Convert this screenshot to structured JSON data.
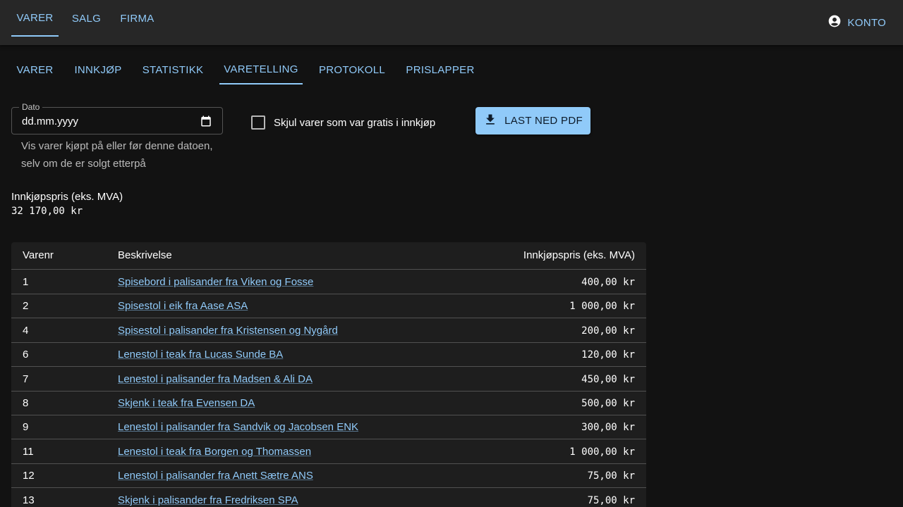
{
  "topnav": {
    "tabs": [
      "VARER",
      "SALG",
      "FIRMA"
    ],
    "active": "VARER",
    "account_label": "KONTO",
    "account_icon": "account-circle-icon"
  },
  "subnav": {
    "tabs": [
      "VARER",
      "INNKJØP",
      "STATISTIKK",
      "VARETELLING",
      "PROTOKOLL",
      "PRISLAPPER"
    ],
    "active": "VARETELLING"
  },
  "filters": {
    "date_label": "Dato",
    "date_value": "dd.mm.yyyy",
    "date_icon": "calendar-icon",
    "helper_text": "Vis varer kjøpt på eller før denne datoen, selv om de er solgt etterpå",
    "checkbox_label": "Skjul varer som var gratis i innkjøp",
    "checkbox_checked": false,
    "pdf_button_label": "LAST NED PDF",
    "pdf_button_icon": "download-icon"
  },
  "summary": {
    "label": "Innkjøpspris (eks. MVA)",
    "value": "32 170,00 kr"
  },
  "table": {
    "headers": [
      "Varenr",
      "Beskrivelse",
      "Innkjøpspris (eks. MVA)"
    ],
    "rows": [
      {
        "nr": "1",
        "desc": "Spisebord i palisander fra Viken og Fosse",
        "price": "400,00 kr"
      },
      {
        "nr": "2",
        "desc": "Spisestol i eik fra Aase ASA",
        "price": "1 000,00 kr"
      },
      {
        "nr": "4",
        "desc": "Spisestol i palisander fra Kristensen og Nygård",
        "price": "200,00 kr"
      },
      {
        "nr": "6",
        "desc": "Lenestol i teak fra Lucas Sunde BA",
        "price": "120,00 kr"
      },
      {
        "nr": "7",
        "desc": "Lenestol i palisander fra Madsen & Ali DA",
        "price": "450,00 kr"
      },
      {
        "nr": "8",
        "desc": "Skjenk i teak fra Evensen DA",
        "price": "500,00 kr"
      },
      {
        "nr": "9",
        "desc": "Lenestol i palisander fra Sandvik og Jacobsen ENK",
        "price": "300,00 kr"
      },
      {
        "nr": "11",
        "desc": "Lenestol i teak fra Borgen og Thomassen",
        "price": "1 000,00 kr"
      },
      {
        "nr": "12",
        "desc": "Lenestol i palisander fra Anett Sætre ANS",
        "price": "75,00 kr"
      },
      {
        "nr": "13",
        "desc": "Skjenk i palisander fra Fredriksen SPA",
        "price": "75,00 kr"
      }
    ]
  },
  "colors": {
    "background": "#121212",
    "appbar": "#272727",
    "accent": "#90caf9",
    "table_bg": "#1e1e1e"
  }
}
